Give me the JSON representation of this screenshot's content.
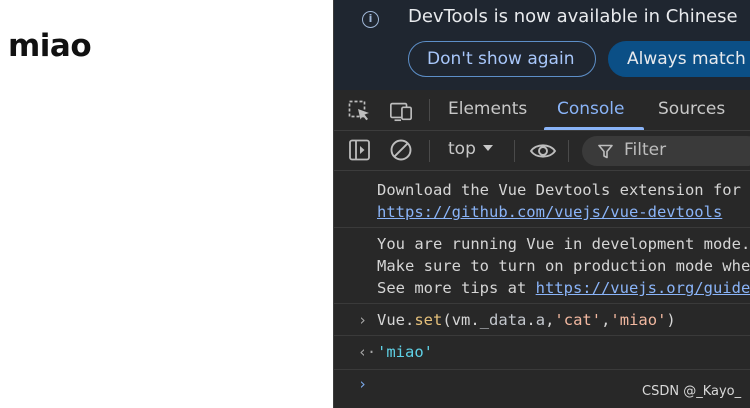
{
  "page": {
    "heading": "miao"
  },
  "devtools": {
    "infobar": {
      "message": "DevTools is now available in Chinese",
      "dont_show_again": "Don't show again",
      "always_match": "Always match Chrome's language"
    },
    "tabs": [
      {
        "label": "Elements",
        "active": false
      },
      {
        "label": "Console",
        "active": true
      },
      {
        "label": "Sources",
        "active": false
      }
    ],
    "toolbar": {
      "context": "top",
      "filter_placeholder": "Filter"
    },
    "console": {
      "messages": [
        {
          "line1": "Download the Vue Devtools extension for a better development experience:",
          "link": "https://github.com/vuejs/vue-devtools"
        },
        {
          "line1": "You are running Vue in development mode.",
          "line2": "Make sure to turn on production mode when deploying for production.",
          "line3_prefix": "See more tips at ",
          "line3_link": "https://vuejs.org/guide/deployment.html"
        }
      ],
      "input": {
        "obj": "Vue",
        "dot1": ".",
        "fn": "set",
        "open": "(",
        "arg_obj": "vm",
        "dot2": ".",
        "arg_prop": "_data",
        "dot3": ".",
        "arg_key": "a",
        "comma1": ",",
        "str1": "'cat'",
        "comma2": ",",
        "str2": "'miao'",
        "close": ")"
      },
      "result": "'miao'"
    }
  },
  "watermark": "CSDN @_Kayo_",
  "colors": {
    "accent": "#8ab4f8",
    "panel_bg": "#282828",
    "infobar_bg": "#1f2630"
  }
}
